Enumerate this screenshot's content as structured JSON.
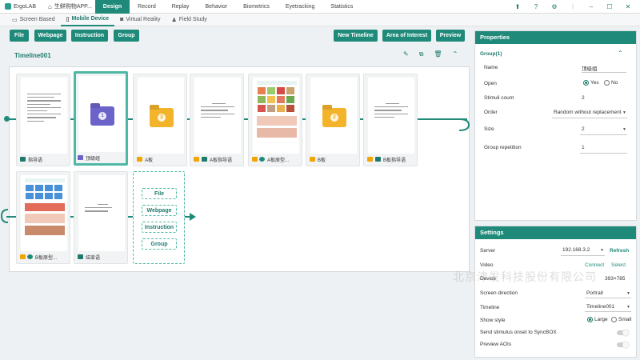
{
  "app": {
    "name": "ErgoLAB",
    "project": "生鲜购物APP..."
  },
  "menu": [
    "Design",
    "Record",
    "Replay",
    "Behavior",
    "Biometrics",
    "Eyetracking",
    "Statistics"
  ],
  "menu_active": "Design",
  "subtabs": [
    {
      "label": "Screen Based",
      "icon": "monitor-icon"
    },
    {
      "label": "Mobile Device",
      "icon": "phone-icon"
    },
    {
      "label": "Virtual Reality",
      "icon": "vr-icon"
    },
    {
      "label": "Field Study",
      "icon": "person-icon"
    }
  ],
  "toolbar": {
    "file": "File",
    "webpage": "Webpage",
    "instruction": "Instruction",
    "group": "Group",
    "new_timeline": "New Timeline",
    "aoi": "Area of Interest",
    "preview": "Preview"
  },
  "timeline": {
    "title": "Timeline001",
    "row1": [
      {
        "label": "指导语",
        "kind": "text",
        "icon": "image-icon"
      },
      {
        "label": "顶级组",
        "kind": "group",
        "num": "1",
        "icon": "group-icon"
      },
      {
        "label": "A板",
        "kind": "folder",
        "num": "2",
        "icon": "folder-icon"
      },
      {
        "label": "A板指导语",
        "kind": "text",
        "icon": "folder-image-icon"
      },
      {
        "label": "A板原型...",
        "kind": "web",
        "icon": "folder-web-icon"
      },
      {
        "label": "B板",
        "kind": "folder",
        "num": "2",
        "icon": "folder-icon"
      },
      {
        "label": "B板指导语",
        "kind": "text",
        "icon": "folder-image-icon"
      }
    ],
    "row2": [
      {
        "label": "B板原型...",
        "kind": "web",
        "icon": "folder-web-icon"
      },
      {
        "label": "结束语",
        "kind": "text",
        "icon": "image-icon"
      }
    ],
    "dropzone": [
      "File",
      "Webpage",
      "Instruction",
      "Group"
    ]
  },
  "properties": {
    "title": "Properties",
    "group_title": "Group(1)",
    "name_label": "Name",
    "name_value": "顶级组",
    "open_label": "Open",
    "open_yes": "Yes",
    "open_no": "No",
    "stimuli_label": "Stimuli count",
    "stimuli_value": "2",
    "order_label": "Order",
    "order_value": "Random without replacement",
    "size_label": "Size",
    "size_value": "2",
    "rep_label": "Group repetition",
    "rep_value": "1"
  },
  "settings": {
    "title": "Settings",
    "server_label": "Server",
    "server_value": "192.168.3.2",
    "refresh": "Refresh",
    "video_label": "Video",
    "connect": "Connect",
    "select": "Select",
    "device_label": "Device",
    "device_value": "393×785",
    "direction_label": "Screen direction",
    "direction_value": "Portrait",
    "timeline_label": "Timeline",
    "timeline_value": "Timeline001",
    "show_label": "Show style",
    "show_large": "Large",
    "show_small": "Small",
    "sync_label": "Send stimulus onset to SyncBOX",
    "aoi_label": "Preview AOIs"
  },
  "watermark": "北京津发科技股份有限公司",
  "colors": {
    "accent": "#1f8a7a",
    "group": "#6b63c9",
    "folder": "#f3b32a"
  }
}
